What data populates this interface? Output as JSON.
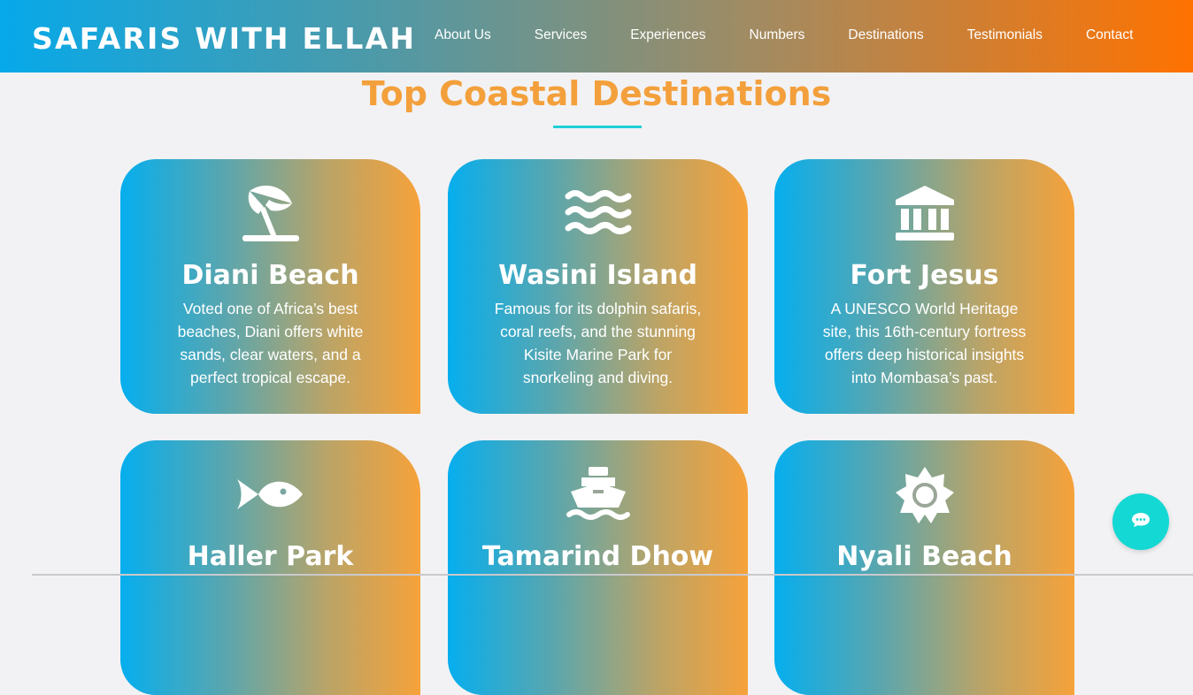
{
  "header": {
    "brand": "SAFARIS WITH ELLAH",
    "nav": [
      {
        "label": "About Us"
      },
      {
        "label": "Services"
      },
      {
        "label": "Experiences"
      },
      {
        "label": "Numbers"
      },
      {
        "label": "Destinations"
      },
      {
        "label": "Testimonials"
      },
      {
        "label": "Contact"
      }
    ]
  },
  "section": {
    "title": "Top Coastal Destinations"
  },
  "cards": [
    {
      "icon": "umbrella-beach-icon",
      "title": "Diani Beach",
      "desc": "Voted one of Africa’s best beaches, Diani offers white sands, clear waters, and a perfect tropical escape."
    },
    {
      "icon": "water-waves-icon",
      "title": "Wasini Island",
      "desc": "Famous for its dolphin safaris, coral reefs, and the stunning Kisite Marine Park for snorkeling and diving."
    },
    {
      "icon": "landmark-icon",
      "title": "Fort Jesus",
      "desc": "A UNESCO World Heritage site, this 16th-century fortress offers deep historical insights into Mombasa’s past."
    },
    {
      "icon": "fish-icon",
      "title": "Haller Park",
      "desc": ""
    },
    {
      "icon": "ship-icon",
      "title": "Tamarind Dhow",
      "desc": ""
    },
    {
      "icon": "sun-icon",
      "title": "Nyali Beach",
      "desc": ""
    }
  ],
  "chat": {
    "icon": "comment-dots-icon"
  },
  "colors": {
    "title_orange": "#f3a03c",
    "underline_teal": "#21cfd6",
    "chat_teal": "#14d8d3",
    "gradient_start": "#06aeee",
    "gradient_end": "#f6a23a"
  }
}
